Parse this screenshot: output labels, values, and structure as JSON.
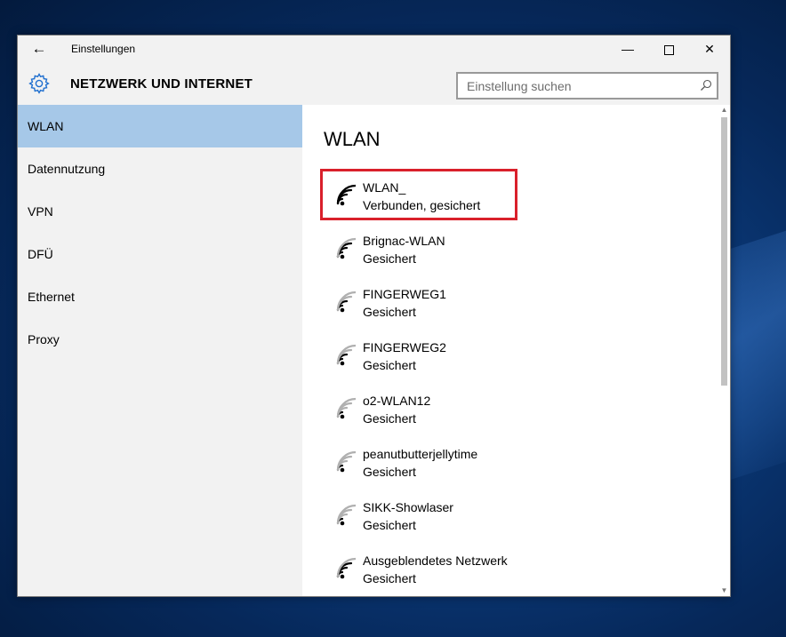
{
  "window": {
    "title": "Einstellungen",
    "back_icon": "←",
    "minimize_icon": "—",
    "close_icon": "✕"
  },
  "header": {
    "title": "NETZWERK UND INTERNET",
    "search_placeholder": "Einstellung suchen",
    "search_value": ""
  },
  "sidebar": {
    "items": [
      {
        "label": "WLAN",
        "selected": true
      },
      {
        "label": "Datennutzung",
        "selected": false
      },
      {
        "label": "VPN",
        "selected": false
      },
      {
        "label": "DFÜ",
        "selected": false
      },
      {
        "label": "Ethernet",
        "selected": false
      },
      {
        "label": "Proxy",
        "selected": false
      }
    ]
  },
  "main": {
    "title": "WLAN",
    "networks": [
      {
        "name": "WLAN_",
        "status": "Verbunden, gesichert",
        "connected": true
      },
      {
        "name": "Brignac-WLAN",
        "status": "Gesichert",
        "connected": false
      },
      {
        "name": "FINGERWEG1",
        "status": "Gesichert",
        "connected": false
      },
      {
        "name": "FINGERWEG2",
        "status": "Gesichert",
        "connected": false
      },
      {
        "name": "o2-WLAN12",
        "status": "Gesichert",
        "connected": false
      },
      {
        "name": "peanutbutterjellytime",
        "status": "Gesichert",
        "connected": false
      },
      {
        "name": "SIKK-Showlaser",
        "status": "Gesichert",
        "connected": false
      },
      {
        "name": "Ausgeblendetes Netzwerk",
        "status": "Gesichert",
        "connected": false
      }
    ]
  },
  "colors": {
    "accent": "#1f6fcf",
    "selection": "#a6c8e8",
    "highlight": "#d9202b",
    "chrome": "#f2f2f2"
  },
  "icons": [
    "back-arrow-icon",
    "minimize-icon",
    "maximize-icon",
    "close-icon",
    "gear-icon",
    "search-icon",
    "wifi-signal-icon"
  ]
}
